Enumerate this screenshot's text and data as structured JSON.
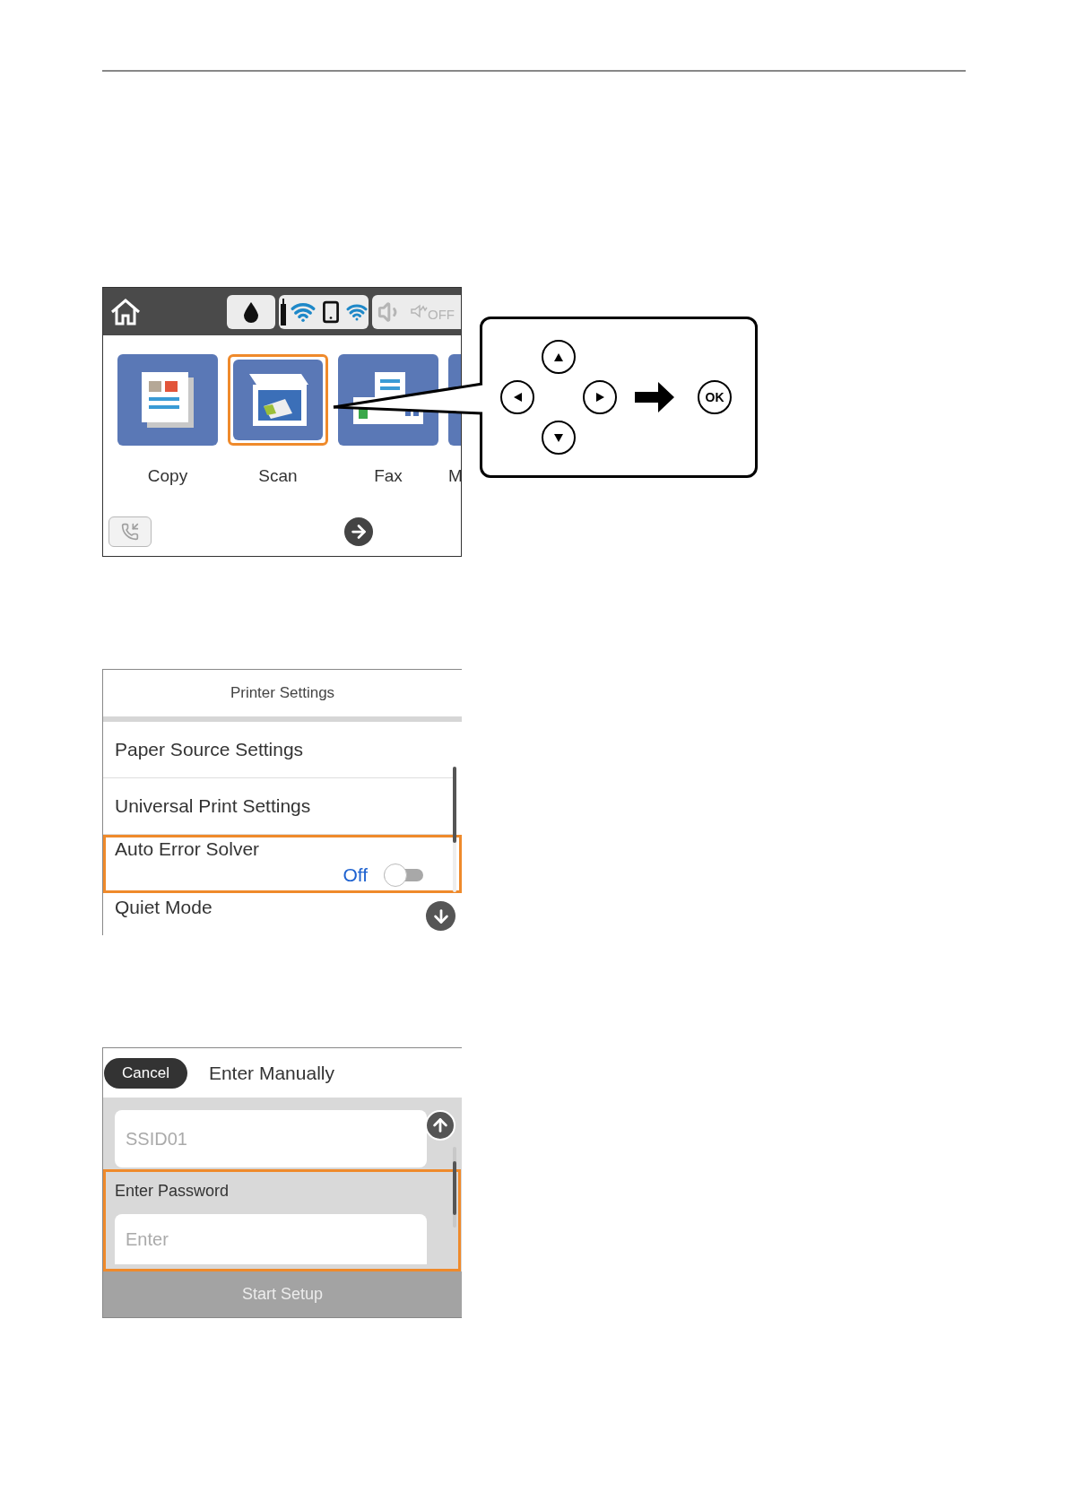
{
  "home_screen": {
    "mute_label": "OFF",
    "tiles": [
      {
        "label": "Copy",
        "kind": "copy",
        "selected": false
      },
      {
        "label": "Scan",
        "kind": "scan",
        "selected": true
      },
      {
        "label": "Fax",
        "kind": "fax",
        "selected": false
      },
      {
        "label": "M",
        "kind": "blank",
        "selected": false
      }
    ]
  },
  "control_panel": {
    "ok_label": "OK"
  },
  "printer_settings": {
    "title": "Printer Settings",
    "items": [
      {
        "label": "Paper Source Settings",
        "kind": "link",
        "selected": false
      },
      {
        "label": "Universal Print Settings",
        "kind": "link",
        "selected": false
      },
      {
        "label": "Auto Error Solver",
        "kind": "toggle",
        "selected": true,
        "value": "Off",
        "on": false
      },
      {
        "label": "Quiet Mode",
        "kind": "link",
        "selected": false
      }
    ]
  },
  "enter_manually": {
    "cancel": "Cancel",
    "title": "Enter Manually",
    "ssid": "SSID01",
    "password_label": "Enter Password",
    "password_placeholder": "Enter",
    "password_selected": true,
    "start": "Start Setup",
    "start_disabled": true
  }
}
